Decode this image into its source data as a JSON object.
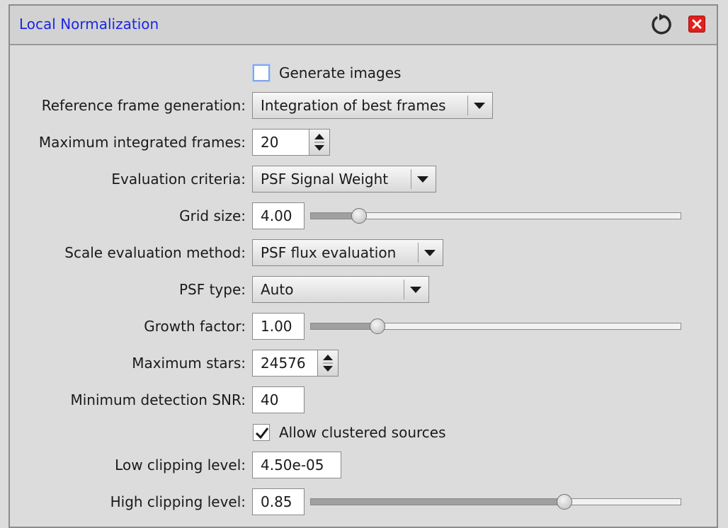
{
  "window": {
    "title": "Local Normalization",
    "reset_icon": "reset-icon",
    "close_icon": "close-icon",
    "accent_color": "#1a26e6",
    "close_color": "#e0201c"
  },
  "generate_images": {
    "label": "Generate images",
    "checked": false
  },
  "reference_frame_generation": {
    "label": "Reference frame generation:",
    "value": "Integration of best frames"
  },
  "maximum_integrated_frames": {
    "label": "Maximum integrated frames:",
    "value": "20"
  },
  "evaluation_criteria": {
    "label": "Evaluation criteria:",
    "value": "PSF Signal Weight"
  },
  "grid_size": {
    "label": "Grid size:",
    "value": "4.00",
    "slider_fraction": 0.13
  },
  "scale_evaluation_method": {
    "label": "Scale evaluation method:",
    "value": "PSF flux evaluation"
  },
  "psf_type": {
    "label": "PSF type:",
    "value": "Auto"
  },
  "growth_factor": {
    "label": "Growth factor:",
    "value": "1.00",
    "slider_fraction": 0.18
  },
  "maximum_stars": {
    "label": "Maximum stars:",
    "value": "24576"
  },
  "minimum_detection_snr": {
    "label": "Minimum detection SNR:",
    "value": "40"
  },
  "allow_clustered_sources": {
    "label": "Allow clustered sources",
    "checked": true
  },
  "low_clipping_level": {
    "label": "Low clipping level:",
    "value": "4.50e-05"
  },
  "high_clipping_level": {
    "label": "High clipping level:",
    "value": "0.85",
    "slider_fraction": 0.685
  }
}
